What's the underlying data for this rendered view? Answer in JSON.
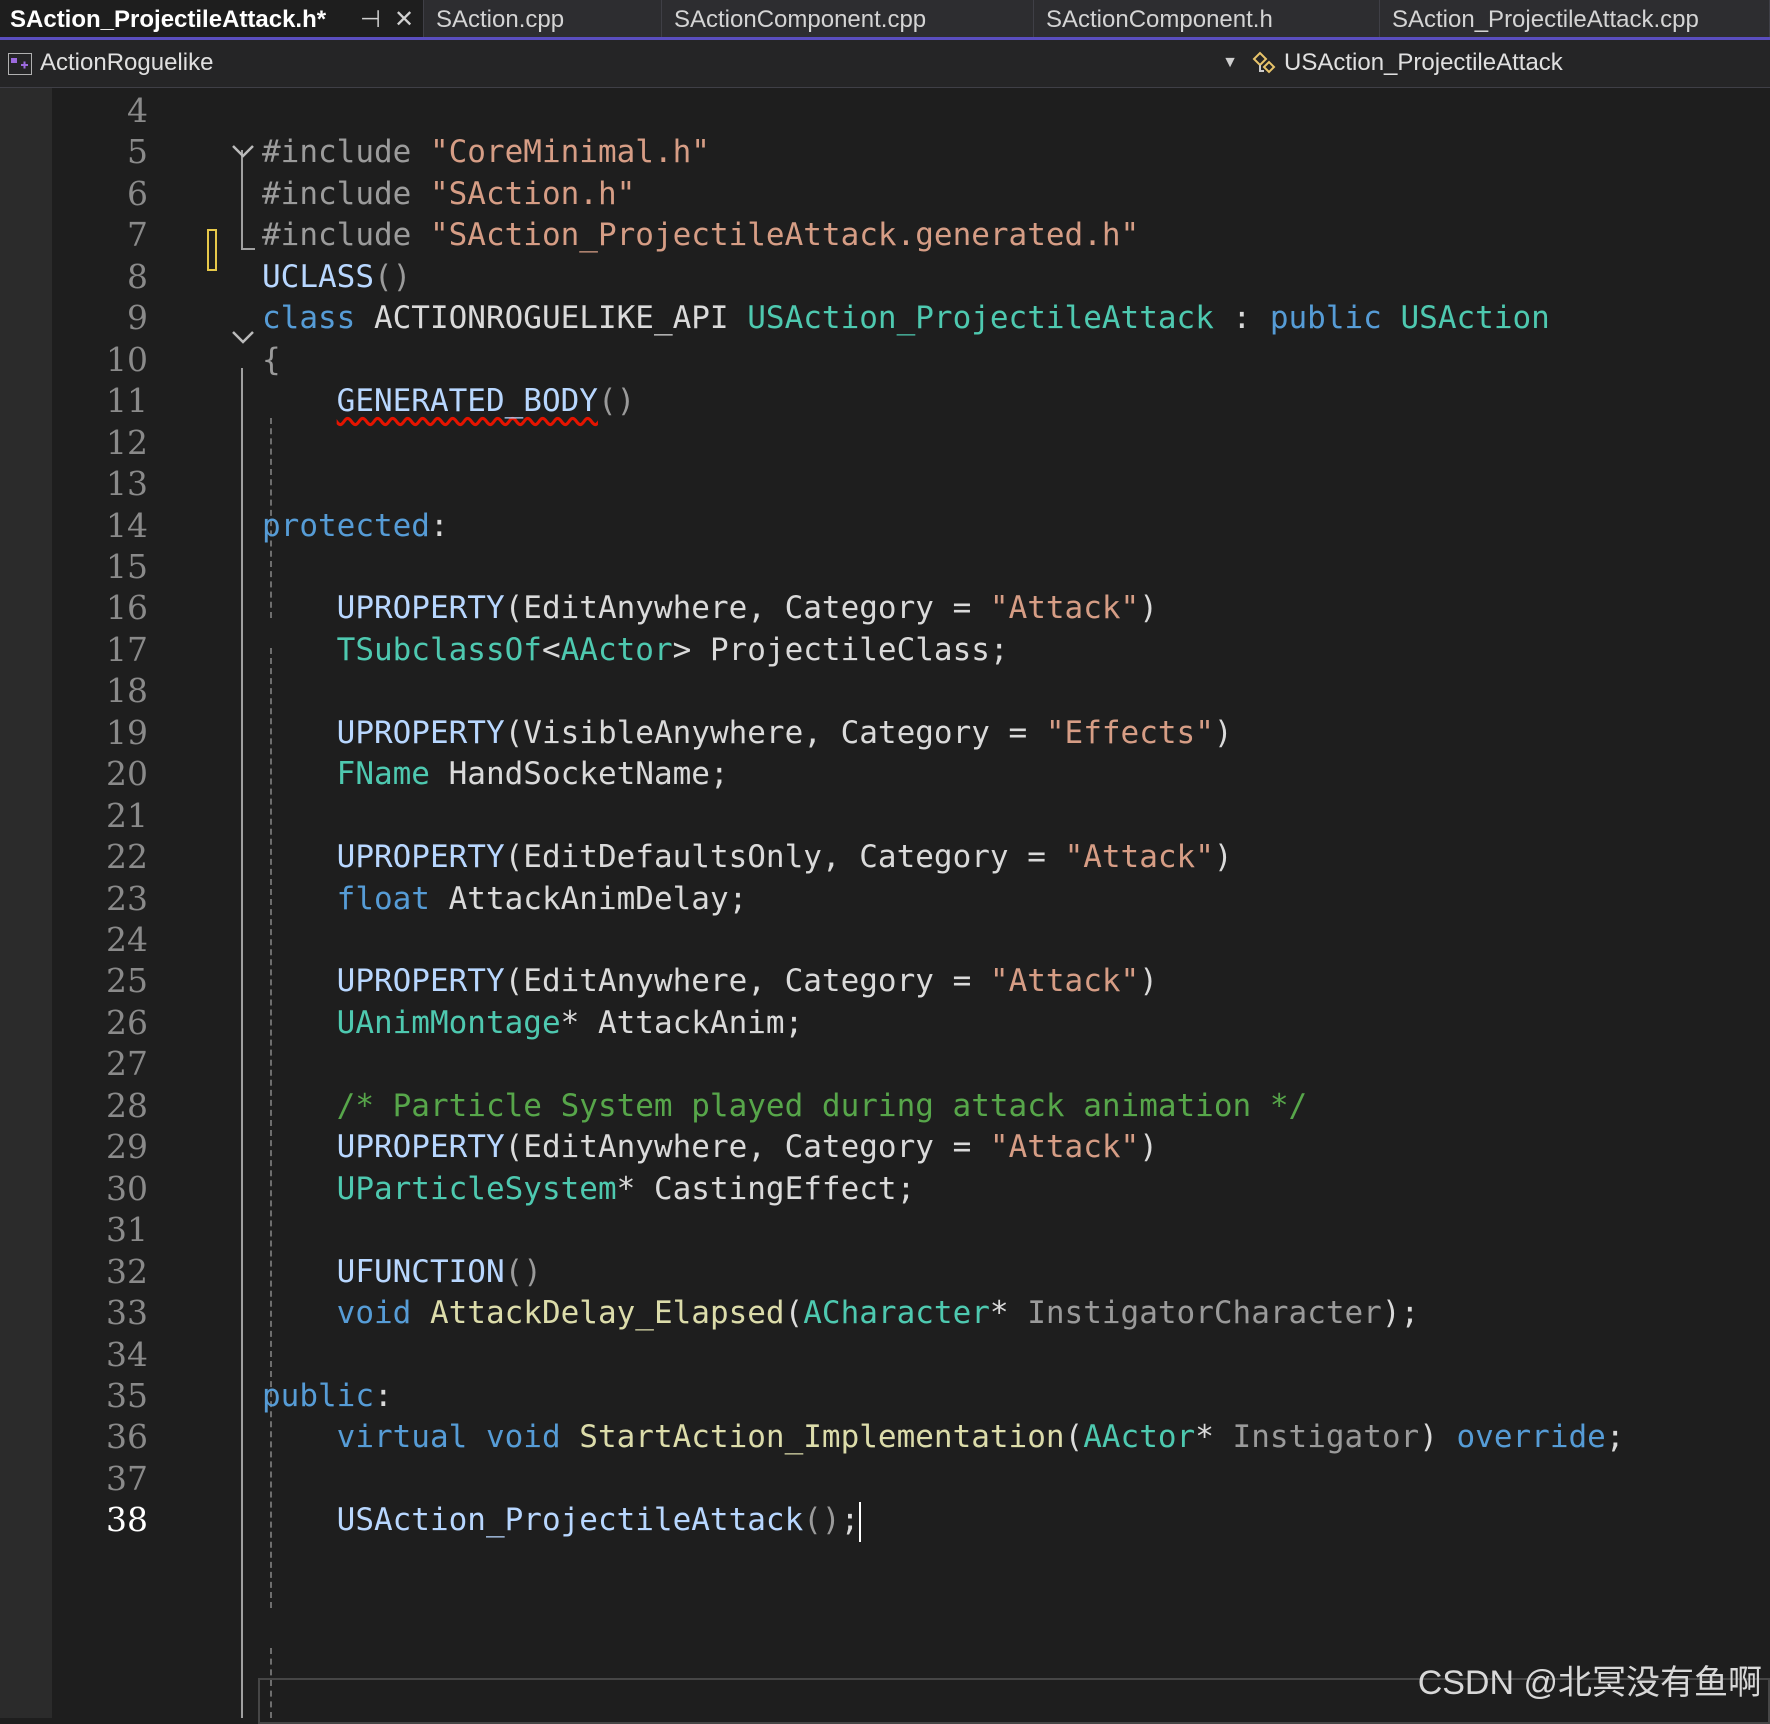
{
  "tabs": [
    {
      "label": "SAction_ProjectileAttack.h*",
      "pin_icon": "⊣",
      "close_icon": "✕"
    },
    {
      "label": "SAction.cpp"
    },
    {
      "label": "SActionComponent.cpp"
    },
    {
      "label": "SActionComponent.h"
    },
    {
      "label": "SAction_ProjectileAttack.cpp"
    }
  ],
  "navbar": {
    "project": "ActionRoguelike",
    "scope": "USAction_ProjectileAttack"
  },
  "editor": {
    "current_line": "38",
    "lines": [
      {
        "n": "4",
        "segs": []
      },
      {
        "n": "5",
        "segs": [
          [
            "pre",
            "#include "
          ],
          [
            "str",
            "\"CoreMinimal.h\""
          ]
        ]
      },
      {
        "n": "6",
        "segs": [
          [
            "pre",
            "#include "
          ],
          [
            "str",
            "\"SAction.h\""
          ]
        ]
      },
      {
        "n": "7",
        "segs": [
          [
            "pre",
            "#include "
          ],
          [
            "str",
            "\"SAction_ProjectileAttack.generated.h\""
          ]
        ]
      },
      {
        "n": "8",
        "segs": [
          [
            "mac",
            "UCLASS"
          ],
          [
            "par",
            "()"
          ]
        ]
      },
      {
        "n": "9",
        "segs": [
          [
            "kw",
            "class "
          ],
          [
            "txt",
            "ACTIONROGUELIKE_API "
          ],
          [
            "ty",
            "USAction_ProjectileAttack"
          ],
          [
            "txt",
            " : "
          ],
          [
            "kw",
            "public "
          ],
          [
            "ty",
            "USAction"
          ]
        ]
      },
      {
        "n": "10",
        "segs": [
          [
            "par",
            "{"
          ]
        ]
      },
      {
        "n": "11",
        "segs": [
          [
            "txt",
            "    "
          ],
          [
            "macsq",
            "GENERATED_BODY"
          ],
          [
            "par",
            "()"
          ]
        ]
      },
      {
        "n": "12",
        "segs": []
      },
      {
        "n": "13",
        "segs": []
      },
      {
        "n": "14",
        "segs": [
          [
            "kw",
            "protected"
          ],
          [
            "txt",
            ":"
          ]
        ]
      },
      {
        "n": "15",
        "segs": []
      },
      {
        "n": "16",
        "segs": [
          [
            "txt",
            "    "
          ],
          [
            "mac",
            "UPROPERTY"
          ],
          [
            "txt",
            "(EditAnywhere, Category = "
          ],
          [
            "str",
            "\"Attack\""
          ],
          [
            "txt",
            ")"
          ]
        ]
      },
      {
        "n": "17",
        "segs": [
          [
            "txt",
            "    "
          ],
          [
            "ty",
            "TSubclassOf"
          ],
          [
            "txt",
            "<"
          ],
          [
            "ty",
            "AActor"
          ],
          [
            "txt",
            "> ProjectileClass;"
          ]
        ]
      },
      {
        "n": "18",
        "segs": []
      },
      {
        "n": "19",
        "segs": [
          [
            "txt",
            "    "
          ],
          [
            "mac",
            "UPROPERTY"
          ],
          [
            "txt",
            "(VisibleAnywhere, Category = "
          ],
          [
            "str",
            "\"Effects\""
          ],
          [
            "txt",
            ")"
          ]
        ]
      },
      {
        "n": "20",
        "segs": [
          [
            "txt",
            "    "
          ],
          [
            "ty",
            "FName"
          ],
          [
            "txt",
            " HandSocketName;"
          ]
        ]
      },
      {
        "n": "21",
        "segs": []
      },
      {
        "n": "22",
        "segs": [
          [
            "txt",
            "    "
          ],
          [
            "mac",
            "UPROPERTY"
          ],
          [
            "txt",
            "(EditDefaultsOnly, Category = "
          ],
          [
            "str",
            "\"Attack\""
          ],
          [
            "txt",
            ")"
          ]
        ]
      },
      {
        "n": "23",
        "segs": [
          [
            "txt",
            "    "
          ],
          [
            "kw",
            "float"
          ],
          [
            "txt",
            " AttackAnimDelay;"
          ]
        ]
      },
      {
        "n": "24",
        "segs": []
      },
      {
        "n": "25",
        "segs": [
          [
            "txt",
            "    "
          ],
          [
            "mac",
            "UPROPERTY"
          ],
          [
            "txt",
            "(EditAnywhere, Category = "
          ],
          [
            "str",
            "\"Attack\""
          ],
          [
            "txt",
            ")"
          ]
        ]
      },
      {
        "n": "26",
        "segs": [
          [
            "txt",
            "    "
          ],
          [
            "ty",
            "UAnimMontage"
          ],
          [
            "txt",
            "* AttackAnim;"
          ]
        ]
      },
      {
        "n": "27",
        "segs": []
      },
      {
        "n": "28",
        "segs": [
          [
            "txt",
            "    "
          ],
          [
            "cm",
            "/* Particle System played during attack animation */"
          ]
        ]
      },
      {
        "n": "29",
        "segs": [
          [
            "txt",
            "    "
          ],
          [
            "mac",
            "UPROPERTY"
          ],
          [
            "txt",
            "(EditAnywhere, Category = "
          ],
          [
            "str",
            "\"Attack\""
          ],
          [
            "txt",
            ")"
          ]
        ]
      },
      {
        "n": "30",
        "segs": [
          [
            "txt",
            "    "
          ],
          [
            "ty",
            "UParticleSystem"
          ],
          [
            "txt",
            "* CastingEffect;"
          ]
        ]
      },
      {
        "n": "31",
        "segs": []
      },
      {
        "n": "32",
        "segs": [
          [
            "txt",
            "    "
          ],
          [
            "mac",
            "UFUNCTION"
          ],
          [
            "par",
            "()"
          ]
        ]
      },
      {
        "n": "33",
        "segs": [
          [
            "txt",
            "    "
          ],
          [
            "kw",
            "void "
          ],
          [
            "fn",
            "AttackDelay_Elapsed"
          ],
          [
            "txt",
            "("
          ],
          [
            "ty",
            "ACharacter"
          ],
          [
            "txt",
            "* "
          ],
          [
            "par",
            "InstigatorCharacter"
          ],
          [
            "txt",
            ");"
          ]
        ]
      },
      {
        "n": "34",
        "segs": []
      },
      {
        "n": "35",
        "segs": [
          [
            "kw",
            "public"
          ],
          [
            "txt",
            ":"
          ]
        ]
      },
      {
        "n": "36",
        "segs": [
          [
            "txt",
            "    "
          ],
          [
            "kw",
            "virtual void "
          ],
          [
            "fn",
            "StartAction_Implementation"
          ],
          [
            "txt",
            "("
          ],
          [
            "ty",
            "AActor"
          ],
          [
            "txt",
            "* "
          ],
          [
            "par",
            "Instigator"
          ],
          [
            "txt",
            ") "
          ],
          [
            "kw",
            "override"
          ],
          [
            "txt",
            ";"
          ]
        ]
      },
      {
        "n": "37",
        "segs": []
      },
      {
        "n": "38",
        "segs": [
          [
            "txt",
            "    "
          ],
          [
            "mac",
            "USAction_ProjectileAttack"
          ],
          [
            "par",
            "()"
          ],
          [
            "txt",
            ";"
          ],
          [
            "cursor",
            ""
          ]
        ]
      }
    ]
  },
  "watermark": "CSDN @北冥没有鱼啊"
}
